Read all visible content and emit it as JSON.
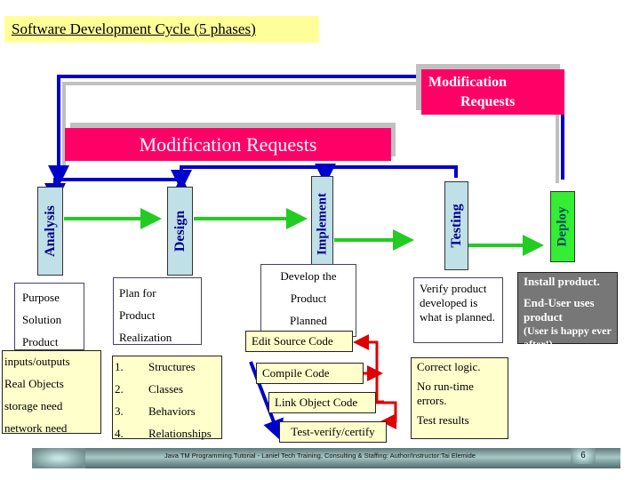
{
  "title": "Software Development Cycle (5 phases)",
  "modification_requests_top": {
    "line1": "Modification",
    "line2": "Requests"
  },
  "modification_requests_main": "Modification Requests",
  "phases": [
    {
      "name": "Analysis",
      "color": "#bfe0e6"
    },
    {
      "name": "Design",
      "color": "#bfe0e6"
    },
    {
      "name": "Implement",
      "color": "#bfe0e6"
    },
    {
      "name": "Testing",
      "color": "#bfe0e6"
    },
    {
      "name": "Deploy",
      "color": "#33ee33"
    }
  ],
  "analysis": {
    "box1": [
      "Purpose",
      "Solution",
      "Product"
    ],
    "box2": [
      "inputs/outputs",
      "Real Objects",
      "storage need",
      "network need"
    ]
  },
  "design": {
    "box1": [
      "Plan for",
      "Product",
      "Realization"
    ],
    "box2": [
      {
        "num": "1.",
        "text": "Structures"
      },
      {
        "num": "2.",
        "text": "Classes"
      },
      {
        "num": "3.",
        "text": "Behaviors"
      },
      {
        "num": "4.",
        "text": "Relationships"
      }
    ]
  },
  "implement": {
    "box1": [
      "Develop the",
      "Product",
      "Planned"
    ],
    "steps": [
      "Edit Source Code",
      "Compile Code",
      "Link Object Code",
      "Test-verify/certify"
    ]
  },
  "testing": {
    "box1": "Verify product developed is what is planned.",
    "box2": [
      "Correct logic.",
      "No run-time errors.",
      "Test results"
    ]
  },
  "deploy": {
    "line1": "Install product.",
    "line2": "End-User uses product",
    "line3": "(User is happy ever after!)"
  },
  "footer": {
    "text": "Java TM Programming.Tutorial - Laniel Tech Training, Consulting & Staffing: Author/Instructor:Tai Elemide",
    "page": "6"
  },
  "colors": {
    "feedback_arrow": "#0000cc",
    "flow_arrow": "#22cc22",
    "loop_arrow": "#dd0000",
    "modification_box": "#ff0066",
    "title_bg": "#ffff99"
  }
}
